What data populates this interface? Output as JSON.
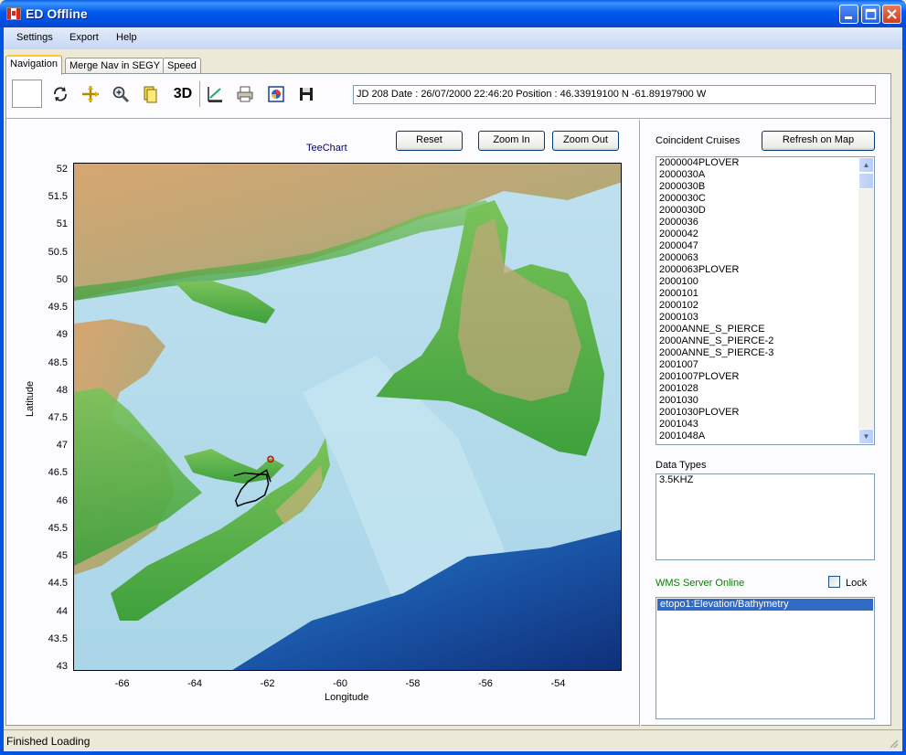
{
  "window": {
    "title": "ED Offline"
  },
  "menu": [
    "Settings",
    "Export",
    "Help"
  ],
  "tabs": [
    "Navigation",
    "Merge Nav in SEGY",
    "Speed"
  ],
  "toolbar": {
    "icons": [
      "refresh-icon",
      "pan-icon",
      "zoom-icon",
      "layer-icon",
      "3d-button",
      "chart-edit-icon",
      "print-icon",
      "export-image-icon",
      "save-icon"
    ],
    "label_3d": "3D",
    "position_text": "JD 208 Date : 26/07/2000 22:46:20  Position : 46.33919100 N -61.89197900 W"
  },
  "chart_controls": {
    "reset": "Reset",
    "zoom_in": "Zoom In",
    "zoom_out": "Zoom Out"
  },
  "chart_data": {
    "type": "scatter",
    "title": "TeeChart",
    "xlabel": "Longitude",
    "ylabel": "Latitude",
    "xlim": [
      -67.3,
      -52.2
    ],
    "ylim": [
      42.9,
      52.1
    ],
    "x_ticks": [
      "-66",
      "-64",
      "-62",
      "-60",
      "-58",
      "-56",
      "-54"
    ],
    "y_ticks": [
      "52",
      "51.5",
      "51",
      "50.5",
      "50",
      "49.5",
      "49",
      "48.5",
      "48",
      "47.5",
      "47",
      "46.5",
      "46",
      "45.5",
      "45",
      "44.5",
      "44",
      "43.5",
      "43"
    ],
    "series": [
      {
        "name": "",
        "points": [
          [
            -62.9,
            46.45
          ],
          [
            -62.6,
            46.5
          ],
          [
            -62.3,
            46.48
          ],
          [
            -62.0,
            46.47
          ],
          [
            -61.95,
            46.3
          ],
          [
            -62.05,
            46.1
          ],
          [
            -62.3,
            46.0
          ],
          [
            -62.6,
            45.95
          ],
          [
            -62.8,
            45.9
          ],
          [
            -62.85,
            46.0
          ],
          [
            -62.7,
            46.2
          ],
          [
            -62.5,
            46.35
          ],
          [
            -62.0,
            46.55
          ],
          [
            -61.89,
            46.34
          ]
        ]
      },
      {
        "name": "",
        "points": [
          [
            -61.89,
            46.75
          ]
        ]
      }
    ]
  },
  "right_panel": {
    "coincident_label": "Coincident Cruises",
    "refresh_button": "Refresh on Map",
    "cruises": [
      "2000004PLOVER",
      "2000030A",
      "2000030B",
      "2000030C",
      "2000030D",
      "2000036",
      "2000042",
      "2000047",
      "2000063",
      "2000063PLOVER",
      "2000100",
      "2000101",
      "2000102",
      "2000103",
      "2000ANNE_S_PIERCE",
      "2000ANNE_S_PIERCE-2",
      "2000ANNE_S_PIERCE-3",
      "2001007",
      "2001007PLOVER",
      "2001028",
      "2001030",
      "2001030PLOVER",
      "2001043",
      "2001048A"
    ],
    "data_types_label": "Data Types",
    "data_types": [
      "3.5KHZ"
    ],
    "wms_label": "WMS Server Online",
    "wms_color": "#008000",
    "lock_label": "Lock",
    "wms_layers": [
      "etopo1:Elevation/Bathymetry"
    ]
  },
  "status": {
    "text": "Finished Loading"
  }
}
